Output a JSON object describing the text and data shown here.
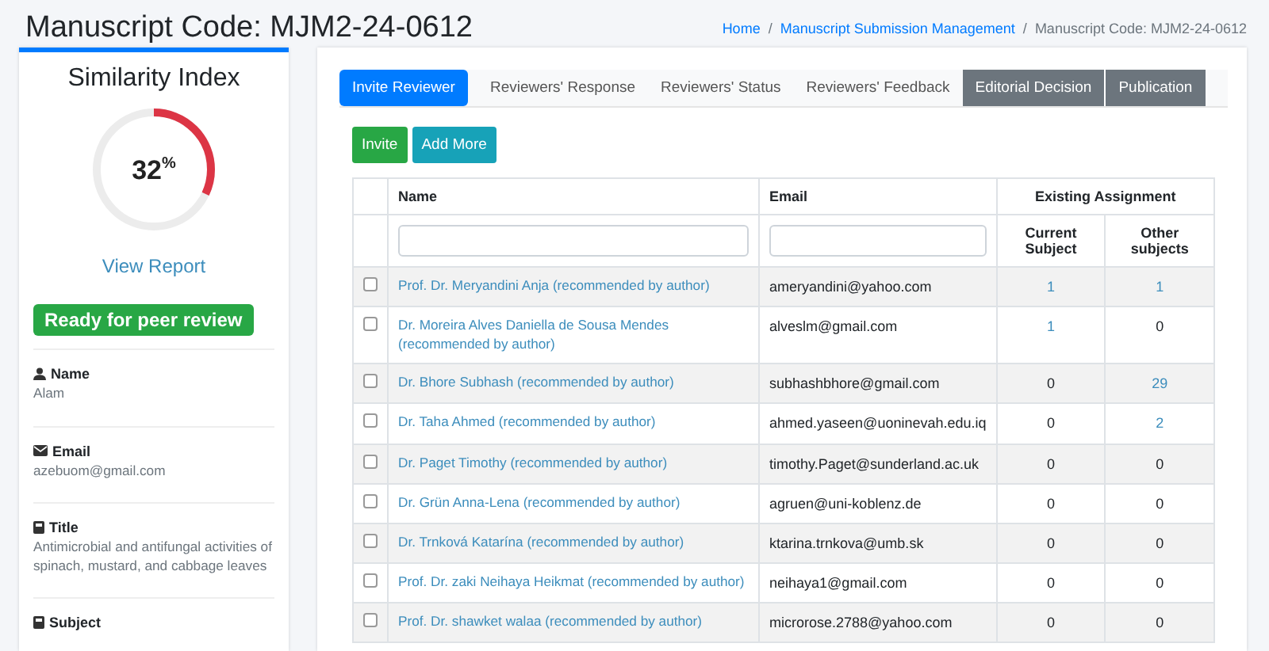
{
  "page_title": "Manuscript Code: MJM2-24-0612",
  "breadcrumb_separator": "/",
  "breadcrumb": [
    {
      "text": "Home",
      "link": true
    },
    {
      "text": "Manuscript Submission Management",
      "link": true
    },
    {
      "text": "Manuscript Code: MJM2-24-0612",
      "link": false
    }
  ],
  "similarity": {
    "title": "Similarity Index",
    "value": "32",
    "unit": "%",
    "level": 0.32,
    "link": "View Report"
  },
  "status_badge": "Ready for peer review",
  "details": [
    {
      "kind": "person",
      "label": "Name",
      "value": "Alam"
    },
    {
      "kind": "email",
      "label": "Email",
      "value": "azebuom@gmail.com"
    },
    {
      "kind": "book",
      "label": "Title",
      "value": "Antimicrobial and antifungal activities of spinach, mustard, and cabbage leaves"
    },
    {
      "kind": "book",
      "label": "Subject"
    }
  ],
  "tabs": [
    {
      "label": "Invite Reviewer",
      "kind": "pill",
      "selected": true
    },
    {
      "label": "Reviewers' Response",
      "kind": "pill",
      "selected": false
    },
    {
      "label": "Reviewers' Status",
      "kind": "pill",
      "selected": false
    },
    {
      "label": "Reviewers' Feedback",
      "kind": "pill",
      "selected": false
    },
    {
      "label": "Editorial Decision",
      "kind": "dark",
      "selected": false
    },
    {
      "label": "Publication",
      "kind": "dark",
      "selected": false
    }
  ],
  "actions": [
    {
      "label": "Invite",
      "kind": "success"
    },
    {
      "label": "Add More",
      "kind": "info"
    }
  ],
  "table": {
    "columns": [
      "Name",
      "Email",
      "Existing Assignment"
    ],
    "subcolumns": [
      "Current Subject",
      "Other subjects"
    ],
    "rows": [
      {
        "checked": false,
        "name": "Prof. Dr. Meryandini Anja (recommended by author)",
        "email": "ameryandini@yahoo.com",
        "current": {
          "text": "1",
          "link": true
        },
        "other": {
          "text": "1",
          "link": true
        }
      },
      {
        "checked": false,
        "name": "Dr. Moreira Alves Daniella de Sousa Mendes (recommended by author)",
        "email": "alveslm@gmail.com",
        "current": {
          "text": "1",
          "link": true
        },
        "other": {
          "text": "0",
          "link": false
        }
      },
      {
        "checked": false,
        "name": "Dr. Bhore Subhash (recommended by author)",
        "email": "subhashbhore@gmail.com",
        "current": {
          "text": "0",
          "link": false
        },
        "other": {
          "text": "29",
          "link": true
        }
      },
      {
        "checked": false,
        "name": "Dr. Taha Ahmed (recommended by author)",
        "email": "ahmed.yaseen@uoninevah.edu.iq",
        "current": {
          "text": "0",
          "link": false
        },
        "other": {
          "text": "2",
          "link": true
        }
      },
      {
        "checked": false,
        "name": "Dr. Paget Timothy (recommended by author)",
        "email": "timothy.Paget@sunderland.ac.uk",
        "current": {
          "text": "0",
          "link": false
        },
        "other": {
          "text": "0",
          "link": false
        }
      },
      {
        "checked": false,
        "name": "Dr. Grün Anna-Lena (recommended by author)",
        "email": "agruen@uni-koblenz.de",
        "current": {
          "text": "0",
          "link": false
        },
        "other": {
          "text": "0",
          "link": false
        }
      },
      {
        "checked": false,
        "name": "Dr. Trnková Katarína (recommended by author)",
        "email": "ktarina.trnkova@umb.sk",
        "current": {
          "text": "0",
          "link": false
        },
        "other": {
          "text": "0",
          "link": false
        }
      },
      {
        "checked": false,
        "name": "Prof. Dr. zaki Neihaya Heikmat (recommended by author)",
        "email": "neihaya1@gmail.com",
        "current": {
          "text": "0",
          "link": false
        },
        "other": {
          "text": "0",
          "link": false
        }
      },
      {
        "checked": false,
        "name": "Prof. Dr. shawket walaa (recommended by author)",
        "email": "microrose.2788@yahoo.com",
        "current": {
          "text": "0",
          "link": false
        },
        "other": {
          "text": "0",
          "link": false
        }
      }
    ]
  }
}
